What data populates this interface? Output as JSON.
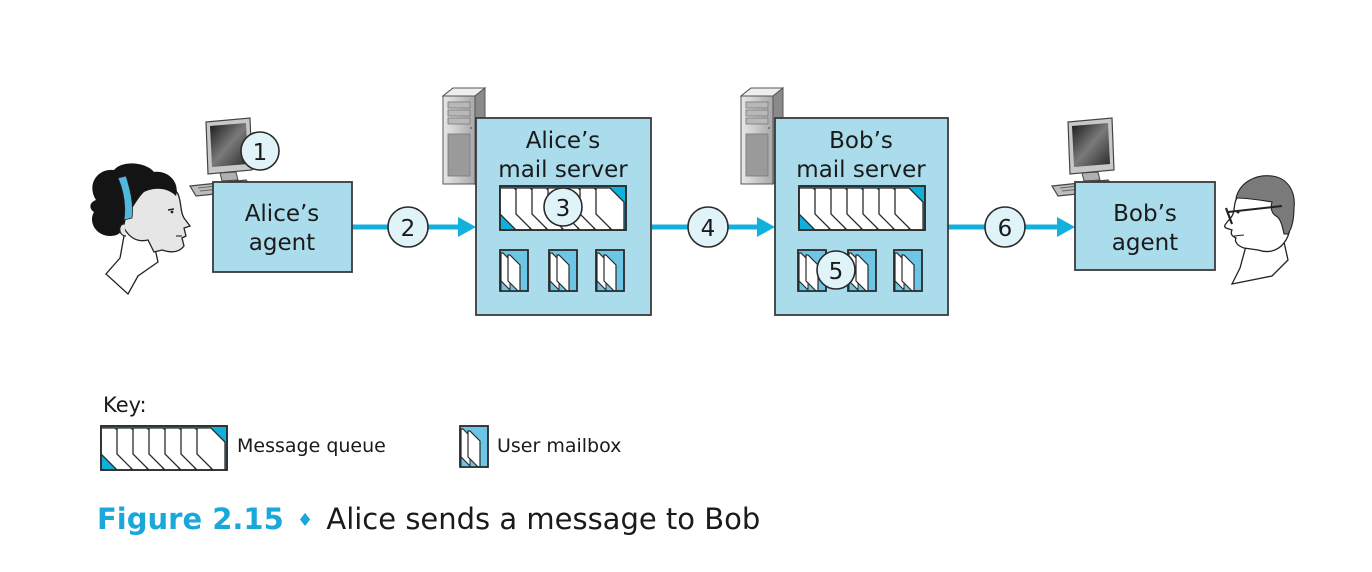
{
  "colors": {
    "box_fill": "#aadcec",
    "box_stroke": "#3a3a3a",
    "arrow": "#12b0dc",
    "step_circle_fill": "#e0f3f9",
    "queue_accent": "#10b0dc",
    "mailbox_accent": "#6ec6e6",
    "caption_accent": "#1aa8db"
  },
  "nodes": {
    "alice_agent": {
      "line1": "Alice’s",
      "line2": "agent"
    },
    "alice_server": {
      "line1": "Alice’s",
      "line2": "mail server"
    },
    "bob_server": {
      "line1": "Bob’s",
      "line2": "mail server"
    },
    "bob_agent": {
      "line1": "Bob’s",
      "line2": "agent"
    }
  },
  "steps": [
    "1",
    "2",
    "3",
    "4",
    "5",
    "6"
  ],
  "key": {
    "title": "Key:",
    "message_queue": "Message queue",
    "user_mailbox": "User mailbox"
  },
  "caption": {
    "figure": "Figure 2.15",
    "separator": "♦",
    "title": "Alice sends a message to Bob"
  },
  "icons": {
    "alice": "person-alice-icon",
    "bob": "person-bob-icon",
    "desktop": "desktop-computer-icon",
    "server": "server-tower-icon"
  }
}
